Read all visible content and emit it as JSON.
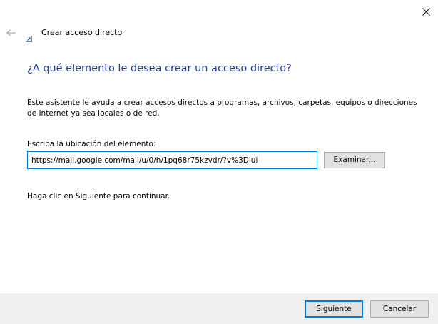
{
  "window": {
    "title": "Crear acceso directo",
    "close_icon": "close-icon",
    "back_icon": "back-arrow-icon",
    "title_icon": "shortcut-icon"
  },
  "wizard": {
    "heading": "¿A qué elemento le desea crear un acceso directo?",
    "description": "Este asistente le ayuda a crear accesos directos a programas, archivos, carpetas, equipos o direcciones de Internet ya sea locales o de red.",
    "location_label": "Escriba la ubicación del elemento:",
    "location_value": "https://mail.google.com/mail/u/0/h/1pq68r75kzvdr/?v%3Dlui",
    "browse_label": "Examinar...",
    "hint": "Haga clic en Siguiente para continuar."
  },
  "footer": {
    "next_label": "Siguiente",
    "cancel_label": "Cancelar"
  },
  "colors": {
    "heading": "#1f3f9a",
    "accent": "#0078d7",
    "footer_bg": "#f0f0f0"
  }
}
